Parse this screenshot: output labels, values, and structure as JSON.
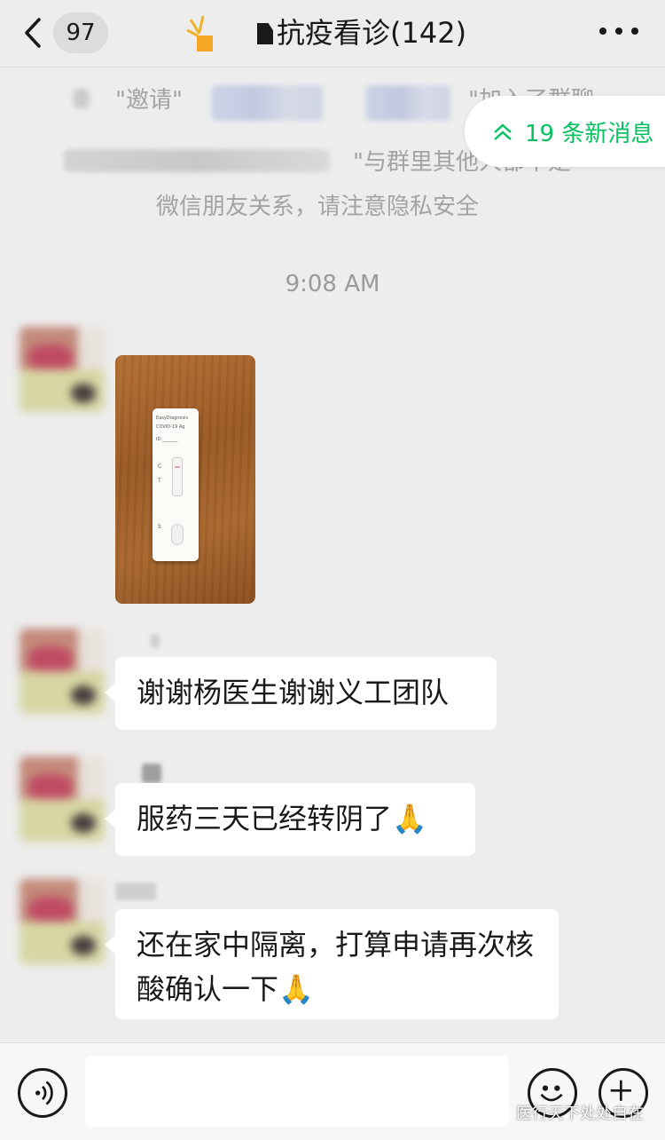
{
  "header": {
    "unread_count": "97",
    "title": "抗疫看诊(142)"
  },
  "system_notice": {
    "invite_word": "\"邀请\"",
    "joined_text": "\"加入了群聊",
    "warning_line1": "\"与群里其他人都不是",
    "warning_line2": "微信朋友关系，请注意隐私安全"
  },
  "new_messages_pill": "19 条新消息",
  "timestamp": "9:08 AM",
  "test_strip": {
    "brand": "EasyDiagnosis",
    "model": "COVID-19 Ag",
    "id_label": "ID:_______",
    "c_label": "C",
    "t_label": "T",
    "s_label": "S"
  },
  "messages": [
    {
      "type": "image",
      "description_alt": "Antigen test cassette"
    },
    {
      "type": "text",
      "text": "谢谢杨医生谢谢义工团队"
    },
    {
      "type": "text",
      "text": "服药三天已经转阴了🙏"
    },
    {
      "type": "text",
      "text": "还在家中隔离，打算申请再次核酸确认一下🙏"
    }
  ],
  "input": {
    "value": ""
  },
  "watermark": "医行天下处处自在",
  "colors": {
    "accent_green": "#07c160",
    "background": "#ededed",
    "bubble": "#ffffff"
  }
}
